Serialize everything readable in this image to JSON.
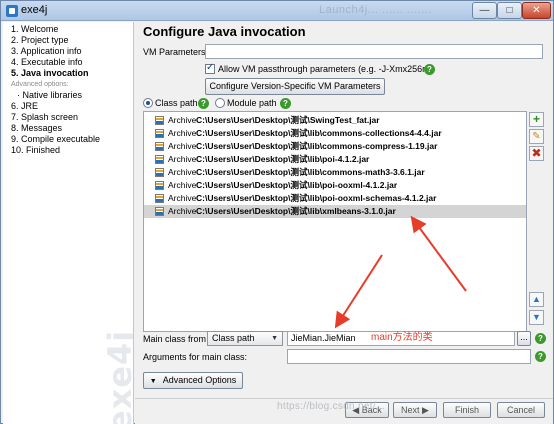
{
  "window": {
    "title": "exe4j",
    "ghost_title": "Launch4j... ...... .......",
    "minimize_glyph": "—",
    "maximize_glyph": "□",
    "close_glyph": "✕"
  },
  "sidebar": {
    "steps": [
      {
        "label": "1. Welcome",
        "kind": "step"
      },
      {
        "label": "2. Project type",
        "kind": "step"
      },
      {
        "label": "3. Application info",
        "kind": "step"
      },
      {
        "label": "4. Executable info",
        "kind": "step"
      },
      {
        "label": "5. Java invocation",
        "kind": "current"
      },
      {
        "label": "Advanced options:",
        "kind": "sub-head"
      },
      {
        "label": "· Native libraries",
        "kind": "sub-item"
      },
      {
        "label": "6. JRE",
        "kind": "step"
      },
      {
        "label": "7. Splash screen",
        "kind": "step"
      },
      {
        "label": "8. Messages",
        "kind": "step"
      },
      {
        "label": "9. Compile executable",
        "kind": "step"
      },
      {
        "label": "10. Finished",
        "kind": "step"
      }
    ],
    "watermark": "exe4j"
  },
  "main": {
    "heading": "Configure Java invocation",
    "vm_parameters_label": "VM Parameters:",
    "vm_parameters_value": "",
    "allow_passthrough_label": "Allow VM passthrough parameters (e.g. -J-Xmx256m)",
    "allow_passthrough_checked": true,
    "configure_vm_button": "Configure Version-Specific VM Parameters",
    "classpath_radio": "Class path",
    "modulepath_radio": "Module path",
    "classpath": [
      {
        "kind": "Archive",
        "path": "C:\\Users\\User\\Desktop\\测试\\SwingTest_fat.jar",
        "selected": false
      },
      {
        "kind": "Archive",
        "path": "C:\\Users\\User\\Desktop\\测试\\lib\\commons-collections4-4.4.jar",
        "selected": false
      },
      {
        "kind": "Archive",
        "path": "C:\\Users\\User\\Desktop\\测试\\lib\\commons-compress-1.19.jar",
        "selected": false
      },
      {
        "kind": "Archive",
        "path": "C:\\Users\\User\\Desktop\\测试\\lib\\poi-4.1.2.jar",
        "selected": false
      },
      {
        "kind": "Archive",
        "path": "C:\\Users\\User\\Desktop\\测试\\lib\\commons-math3-3.6.1.jar",
        "selected": false
      },
      {
        "kind": "Archive",
        "path": "C:\\Users\\User\\Desktop\\测试\\lib\\poi-ooxml-4.1.2.jar",
        "selected": false
      },
      {
        "kind": "Archive",
        "path": "C:\\Users\\User\\Desktop\\测试\\lib\\poi-ooxml-schemas-4.1.2.jar",
        "selected": false
      },
      {
        "kind": "Archive",
        "path": "C:\\Users\\User\\Desktop\\测试\\lib\\xmlbeans-3.1.0.jar",
        "selected": true
      }
    ],
    "main_class_label": "Main class from",
    "main_class_source": "Class path",
    "main_class_value": "JieMian.JieMian",
    "browse_label": "...",
    "arguments_label": "Arguments for main class:",
    "arguments_value": "",
    "advanced_options_button": "Advanced Options",
    "annotation_text": "main方法的类"
  },
  "footer": {
    "blog_watermark": "https://blog.csdn.net/...",
    "back_label": "Back",
    "next_label": "Next",
    "finish_label": "Finish",
    "cancel_label": "Cancel"
  },
  "colors": {
    "accent": "#2b78c4",
    "annotation": "#e53d2a",
    "help": "#3a9a2a"
  }
}
